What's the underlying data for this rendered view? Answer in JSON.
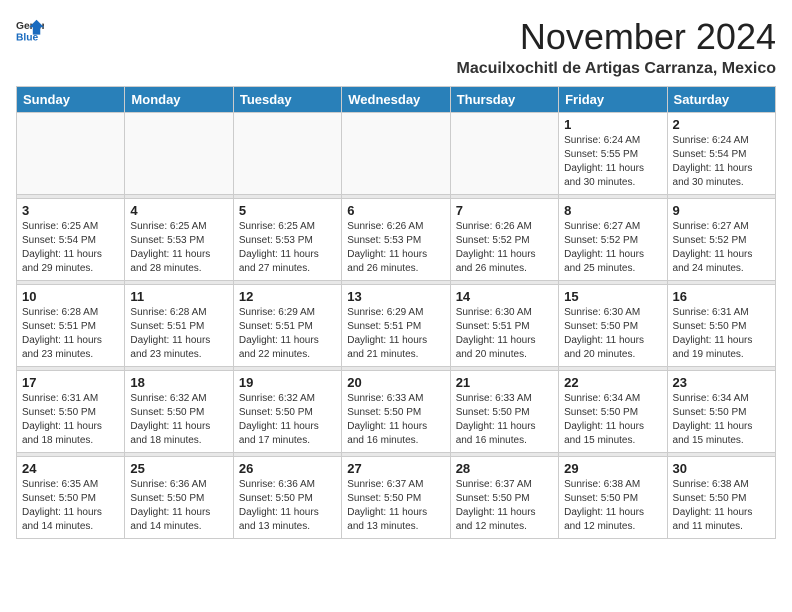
{
  "header": {
    "logo_line1": "General",
    "logo_line2": "Blue",
    "month": "November 2024",
    "location": "Macuilxochitl de Artigas Carranza, Mexico"
  },
  "weekdays": [
    "Sunday",
    "Monday",
    "Tuesday",
    "Wednesday",
    "Thursday",
    "Friday",
    "Saturday"
  ],
  "weeks": [
    [
      {
        "day": "",
        "info": ""
      },
      {
        "day": "",
        "info": ""
      },
      {
        "day": "",
        "info": ""
      },
      {
        "day": "",
        "info": ""
      },
      {
        "day": "",
        "info": ""
      },
      {
        "day": "1",
        "info": "Sunrise: 6:24 AM\nSunset: 5:55 PM\nDaylight: 11 hours and 30 minutes."
      },
      {
        "day": "2",
        "info": "Sunrise: 6:24 AM\nSunset: 5:54 PM\nDaylight: 11 hours and 30 minutes."
      }
    ],
    [
      {
        "day": "3",
        "info": "Sunrise: 6:25 AM\nSunset: 5:54 PM\nDaylight: 11 hours and 29 minutes."
      },
      {
        "day": "4",
        "info": "Sunrise: 6:25 AM\nSunset: 5:53 PM\nDaylight: 11 hours and 28 minutes."
      },
      {
        "day": "5",
        "info": "Sunrise: 6:25 AM\nSunset: 5:53 PM\nDaylight: 11 hours and 27 minutes."
      },
      {
        "day": "6",
        "info": "Sunrise: 6:26 AM\nSunset: 5:53 PM\nDaylight: 11 hours and 26 minutes."
      },
      {
        "day": "7",
        "info": "Sunrise: 6:26 AM\nSunset: 5:52 PM\nDaylight: 11 hours and 26 minutes."
      },
      {
        "day": "8",
        "info": "Sunrise: 6:27 AM\nSunset: 5:52 PM\nDaylight: 11 hours and 25 minutes."
      },
      {
        "day": "9",
        "info": "Sunrise: 6:27 AM\nSunset: 5:52 PM\nDaylight: 11 hours and 24 minutes."
      }
    ],
    [
      {
        "day": "10",
        "info": "Sunrise: 6:28 AM\nSunset: 5:51 PM\nDaylight: 11 hours and 23 minutes."
      },
      {
        "day": "11",
        "info": "Sunrise: 6:28 AM\nSunset: 5:51 PM\nDaylight: 11 hours and 23 minutes."
      },
      {
        "day": "12",
        "info": "Sunrise: 6:29 AM\nSunset: 5:51 PM\nDaylight: 11 hours and 22 minutes."
      },
      {
        "day": "13",
        "info": "Sunrise: 6:29 AM\nSunset: 5:51 PM\nDaylight: 11 hours and 21 minutes."
      },
      {
        "day": "14",
        "info": "Sunrise: 6:30 AM\nSunset: 5:51 PM\nDaylight: 11 hours and 20 minutes."
      },
      {
        "day": "15",
        "info": "Sunrise: 6:30 AM\nSunset: 5:50 PM\nDaylight: 11 hours and 20 minutes."
      },
      {
        "day": "16",
        "info": "Sunrise: 6:31 AM\nSunset: 5:50 PM\nDaylight: 11 hours and 19 minutes."
      }
    ],
    [
      {
        "day": "17",
        "info": "Sunrise: 6:31 AM\nSunset: 5:50 PM\nDaylight: 11 hours and 18 minutes."
      },
      {
        "day": "18",
        "info": "Sunrise: 6:32 AM\nSunset: 5:50 PM\nDaylight: 11 hours and 18 minutes."
      },
      {
        "day": "19",
        "info": "Sunrise: 6:32 AM\nSunset: 5:50 PM\nDaylight: 11 hours and 17 minutes."
      },
      {
        "day": "20",
        "info": "Sunrise: 6:33 AM\nSunset: 5:50 PM\nDaylight: 11 hours and 16 minutes."
      },
      {
        "day": "21",
        "info": "Sunrise: 6:33 AM\nSunset: 5:50 PM\nDaylight: 11 hours and 16 minutes."
      },
      {
        "day": "22",
        "info": "Sunrise: 6:34 AM\nSunset: 5:50 PM\nDaylight: 11 hours and 15 minutes."
      },
      {
        "day": "23",
        "info": "Sunrise: 6:34 AM\nSunset: 5:50 PM\nDaylight: 11 hours and 15 minutes."
      }
    ],
    [
      {
        "day": "24",
        "info": "Sunrise: 6:35 AM\nSunset: 5:50 PM\nDaylight: 11 hours and 14 minutes."
      },
      {
        "day": "25",
        "info": "Sunrise: 6:36 AM\nSunset: 5:50 PM\nDaylight: 11 hours and 14 minutes."
      },
      {
        "day": "26",
        "info": "Sunrise: 6:36 AM\nSunset: 5:50 PM\nDaylight: 11 hours and 13 minutes."
      },
      {
        "day": "27",
        "info": "Sunrise: 6:37 AM\nSunset: 5:50 PM\nDaylight: 11 hours and 13 minutes."
      },
      {
        "day": "28",
        "info": "Sunrise: 6:37 AM\nSunset: 5:50 PM\nDaylight: 11 hours and 12 minutes."
      },
      {
        "day": "29",
        "info": "Sunrise: 6:38 AM\nSunset: 5:50 PM\nDaylight: 11 hours and 12 minutes."
      },
      {
        "day": "30",
        "info": "Sunrise: 6:38 AM\nSunset: 5:50 PM\nDaylight: 11 hours and 11 minutes."
      }
    ]
  ]
}
